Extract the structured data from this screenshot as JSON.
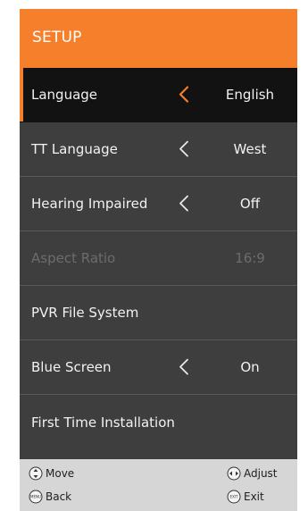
{
  "header": {
    "title": "SETUP"
  },
  "menu": {
    "items": [
      {
        "label": "Language",
        "value": "English",
        "has_arrow": true,
        "state": "selected"
      },
      {
        "label": "TT Language",
        "value": "West",
        "has_arrow": true,
        "state": "normal"
      },
      {
        "label": "Hearing Impaired",
        "value": "Off",
        "has_arrow": true,
        "state": "normal"
      },
      {
        "label": "Aspect Ratio",
        "value": "16:9",
        "has_arrow": false,
        "state": "disabled"
      },
      {
        "label": "PVR File System",
        "value": "",
        "has_arrow": false,
        "state": "normal"
      },
      {
        "label": "Blue Screen",
        "value": "On",
        "has_arrow": true,
        "state": "normal"
      },
      {
        "label": "First Time Installation",
        "value": "",
        "has_arrow": false,
        "state": "normal"
      }
    ]
  },
  "footer": {
    "move": {
      "label": "Move",
      "icon": "up-down-button-icon"
    },
    "back": {
      "label": "Back",
      "icon": "menu-button-icon",
      "icon_text": "MENU"
    },
    "adjust": {
      "label": "Adjust",
      "icon": "left-right-button-icon"
    },
    "exit": {
      "label": "Exit",
      "icon": "exit-button-icon",
      "icon_text": "EXIT"
    }
  },
  "colors": {
    "accent": "#f57f2a",
    "panel": "#3e3e3e",
    "selected_row": "#121212",
    "footer": "#d6d6d6",
    "text": "#f2f2f2",
    "disabled_text": "#6c6c6c"
  }
}
